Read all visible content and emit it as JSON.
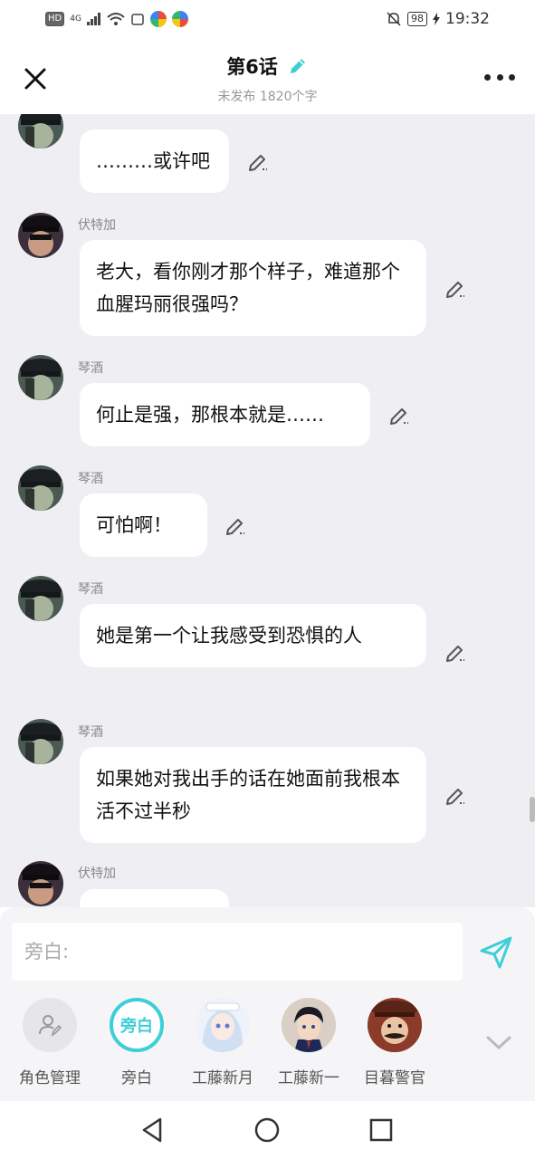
{
  "status_bar": {
    "hd": "HD",
    "network": "4G",
    "battery": "98",
    "time": "19:32"
  },
  "header": {
    "title": "第6话",
    "subtitle": "未发布 1820个字"
  },
  "messages": [
    {
      "speaker": "琴酒",
      "text": "………或许吧"
    },
    {
      "speaker": "伏特加",
      "text": "老大，看你刚才那个样子，难道那个血腥玛丽很强吗？"
    },
    {
      "speaker": "琴酒",
      "text": "何止是强，那根本就是……"
    },
    {
      "speaker": "琴酒",
      "text": "可怕啊！"
    },
    {
      "speaker": "琴酒",
      "text": "她是第一个让我感受到恐惧的人"
    },
    {
      "speaker": "琴酒",
      "text": "如果她对我出手的话在她面前我根本活不过半秒"
    },
    {
      "speaker": "伏特加",
      "text": ""
    }
  ],
  "input": {
    "placeholder": "旁白:"
  },
  "roles": [
    {
      "label": "角色管理",
      "icon": "role-manage-icon"
    },
    {
      "label": "旁白",
      "badge": "旁白"
    },
    {
      "label": "工藤新月"
    },
    {
      "label": "工藤新一"
    },
    {
      "label": "目暮警官"
    }
  ],
  "colors": {
    "accent": "#3ccfd8",
    "chat_bg": "#efeff3",
    "bubble": "#ffffff"
  }
}
